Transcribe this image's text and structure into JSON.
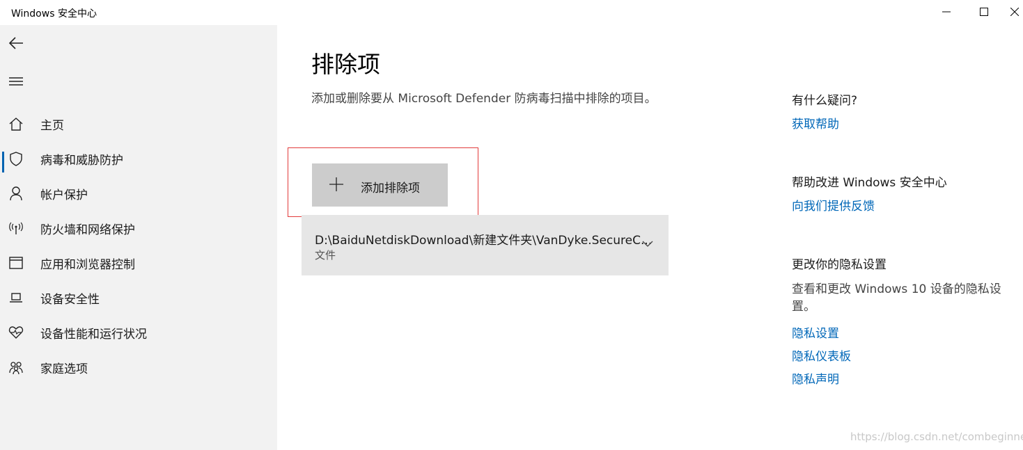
{
  "window": {
    "title": "Windows 安全中心"
  },
  "sidebar": {
    "items": [
      {
        "label": "主页",
        "icon": "home-icon"
      },
      {
        "label": "病毒和威胁防护",
        "icon": "shield-icon",
        "selected": true
      },
      {
        "label": "帐户保护",
        "icon": "person-icon"
      },
      {
        "label": "防火墙和网络保护",
        "icon": "wireless-icon"
      },
      {
        "label": "应用和浏览器控制",
        "icon": "browser-window-icon"
      },
      {
        "label": "设备安全性",
        "icon": "laptop-icon"
      },
      {
        "label": "设备性能和运行状况",
        "icon": "heart-pulse-icon"
      },
      {
        "label": "家庭选项",
        "icon": "family-icon"
      }
    ]
  },
  "main": {
    "title": "排除项",
    "description": "添加或删除要从 Microsoft Defender 防病毒扫描中排除的项目。",
    "add_button_label": "添加排除项",
    "exclusions": [
      {
        "path": "D:\\BaiduNetdiskDownload\\新建文件夹\\VanDyke.SecureC...",
        "type": "文件"
      }
    ]
  },
  "right_panel": {
    "question_heading": "有什么疑问?",
    "get_help_link": "获取帮助",
    "improve_heading": "帮助改进 Windows 安全中心",
    "feedback_link": "向我们提供反馈",
    "privacy_heading": "更改你的隐私设置",
    "privacy_text": "查看和更改 Windows 10 设备的隐私设置。",
    "privacy_settings_link": "隐私设置",
    "privacy_dashboard_link": "隐私仪表板",
    "privacy_statement_link": "隐私声明"
  },
  "watermark": "https://blog.csdn.net/combeginner",
  "colors": {
    "accent": "#0067b8",
    "highlight_box": "#e23b3b",
    "sidebar_bg": "#f2f2f2",
    "button_bg": "#cccccc"
  }
}
